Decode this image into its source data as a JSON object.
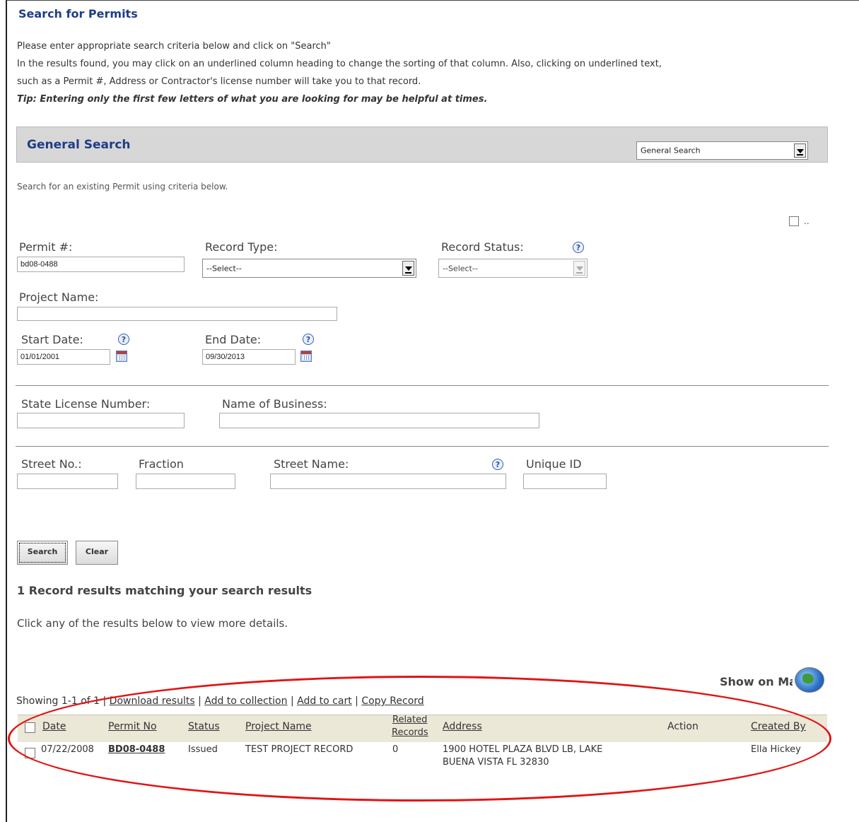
{
  "page_title": "Search for Permits",
  "intro": {
    "line1": "Please enter appropriate search criteria below and click on \"Search\"",
    "line2": "In the results found, you may click on an underlined column heading to change the sorting of that column. Also, clicking on underlined text,",
    "line3": "such as a Permit #, Address or Contractor's license number will take you to that record.",
    "tip": "Tip: Entering only the first few letters of what you are looking for may be helpful at times."
  },
  "general_search": {
    "title": "General Search",
    "select_value": "General Search",
    "description": "Search for an existing Permit using criteria below.",
    "checkbox_label": ".."
  },
  "fields": {
    "permit_label": "Permit #:",
    "permit_value": "bd08-0488",
    "record_type_label": "Record Type:",
    "record_type_value": "--Select--",
    "record_status_label": "Record Status:",
    "record_status_value": "--Select--",
    "project_name_label": "Project Name:",
    "project_name_value": "",
    "start_date_label": "Start Date:",
    "start_date_value": "01/01/2001",
    "end_date_label": "End Date:",
    "end_date_value": "09/30/2013",
    "license_label": "State License Number:",
    "business_label": "Name of Business:",
    "street_no_label": "Street No.:",
    "fraction_label": "Fraction",
    "street_name_label": "Street Name:",
    "unique_id_label": "Unique ID"
  },
  "help_glyph": "?",
  "buttons": {
    "search": "Search",
    "clear": "Clear"
  },
  "results": {
    "count_text": "1 Record results matching your search results",
    "hint": "Click any of the results below to view more details.",
    "show_on_map": "Show on Ma",
    "showing_text": "Showing 1-1 of 1",
    "link_download": "Download results",
    "link_collection": "Add to collection",
    "link_cart": "Add to cart",
    "link_copy": "Copy Record",
    "sep": "|",
    "columns": {
      "date": "Date",
      "permit_no": "Permit No",
      "status": "Status",
      "project_name": "Project Name",
      "related_1": "Related",
      "related_2": "Records",
      "address": "Address",
      "action": "Action",
      "created_by": "Created By"
    },
    "rows": [
      {
        "date": "07/22/2008",
        "permit_no": "BD08-0488",
        "status": "Issued",
        "project_name": "TEST PROJECT RECORD",
        "related": "0",
        "address_1": "1900 HOTEL PLAZA BLVD LB, LAKE",
        "address_2": "BUENA VISTA FL 32830",
        "action": "",
        "created_by": "Ella Hickey"
      }
    ]
  },
  "colors": {
    "title_blue": "#1f3c88",
    "highlight_oval": "#e01414",
    "table_header_bg": "#ece8d8"
  }
}
